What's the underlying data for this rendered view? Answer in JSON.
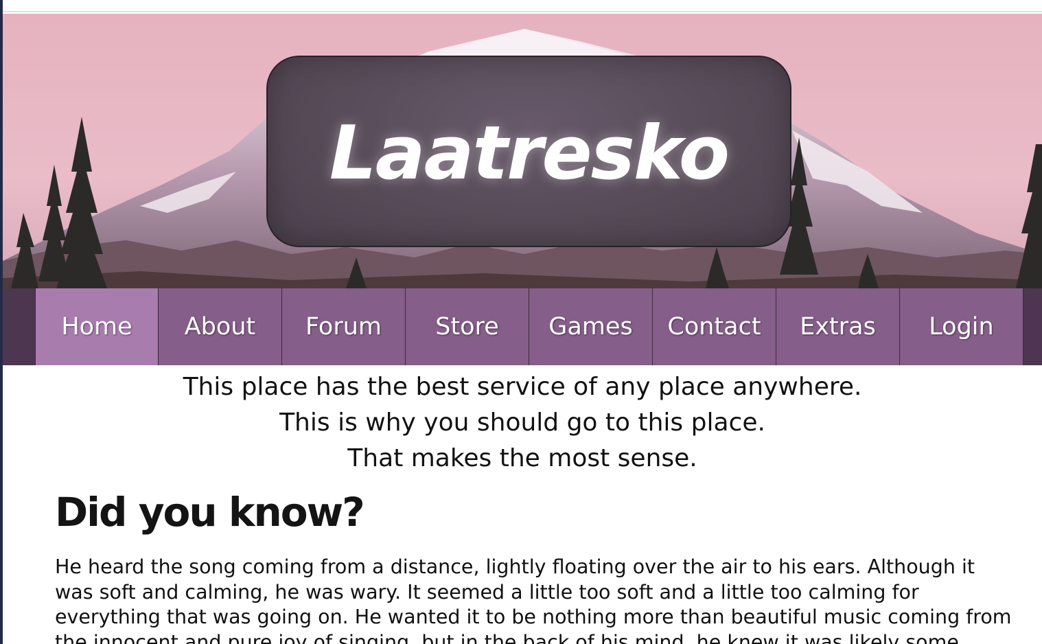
{
  "header": {
    "site_title": "Laatresko"
  },
  "nav": {
    "items": [
      {
        "label": "Home",
        "active": true
      },
      {
        "label": "About",
        "active": false
      },
      {
        "label": "Forum",
        "active": false
      },
      {
        "label": "Store",
        "active": false
      },
      {
        "label": "Games",
        "active": false
      },
      {
        "label": "Contact",
        "active": false
      },
      {
        "label": "Extras",
        "active": false
      },
      {
        "label": "Login",
        "active": false
      }
    ]
  },
  "main": {
    "tagline": [
      "This place has the best service of any place anywhere.",
      "This is why you should go to this place.",
      "That makes the most sense."
    ],
    "section_heading": "Did you know?",
    "section_paragraph": "He heard the song coming from a distance, lightly floating over the air to his ears. Although it was soft and calming, he was wary. It seemed a little too soft and a little too calming for everything that was going on. He wanted it to be nothing more than beautiful music coming from the innocent and pure joy of singing, but in the back of his mind, he knew it was likely some"
  },
  "colors": {
    "nav_background": "#4d3650",
    "nav_item": "#855e89",
    "nav_item_active": "#a97cae",
    "title_box": "#574b58",
    "sky": "#e3b4c0"
  }
}
